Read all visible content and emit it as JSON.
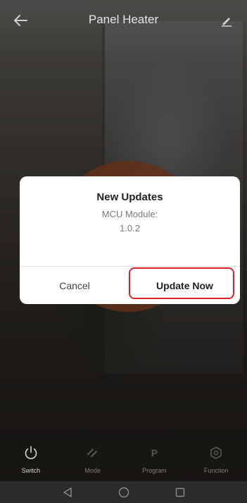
{
  "header": {
    "title": "Panel Heater",
    "back_icon": "arrow-left-icon",
    "edit_icon": "pencil-icon"
  },
  "dialog": {
    "title": "New Updates",
    "message_line1": "MCU Module:",
    "message_line2": "1.0.2",
    "cancel_label": "Cancel",
    "confirm_label": "Update Now"
  },
  "tabbar": {
    "items": [
      {
        "label": "Switch",
        "icon": "power-icon",
        "active": true
      },
      {
        "label": "Mode",
        "icon": "mode-icon",
        "active": false
      },
      {
        "label": "Program",
        "icon": "program-icon",
        "active": false
      },
      {
        "label": "Function",
        "icon": "function-icon",
        "active": false
      }
    ]
  },
  "navbar": {
    "icons": [
      "back-triangle-icon",
      "home-circle-icon",
      "recents-square-icon"
    ]
  },
  "colors": {
    "highlight": "#d8232a",
    "heater_accent": "#b05a30",
    "dialog_bg": "#ffffff"
  }
}
